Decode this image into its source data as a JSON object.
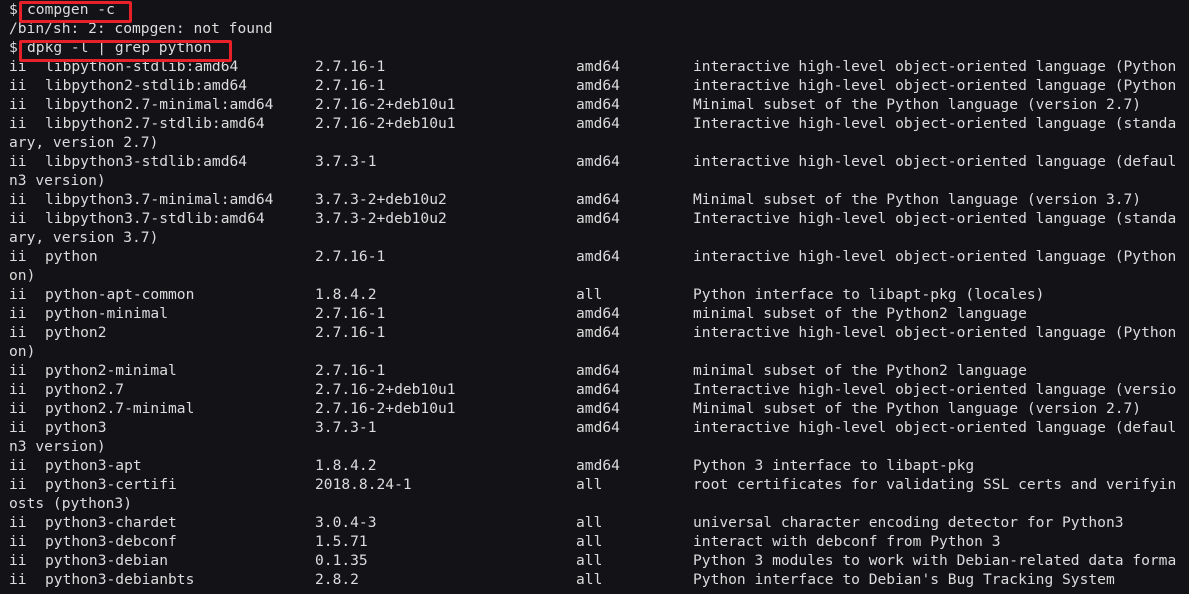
{
  "terminal": {
    "prompt": "$",
    "commands": [
      {
        "text": "compgen -c",
        "highlighted": true
      },
      {
        "text": "dpkg -l | grep python",
        "highlighted": true
      }
    ],
    "error_output": "/bin/sh: 2: compgen: not found",
    "highlight_color": "#e8202a",
    "text_color": "#dcdcdc",
    "background": "#121217",
    "lines": [
      {
        "kind": "cmd",
        "cmd_index": 0
      },
      {
        "kind": "text",
        "text": "/bin/sh: 2: compgen: not found"
      },
      {
        "kind": "cmd",
        "cmd_index": 1
      },
      {
        "kind": "pkg",
        "status": "ii",
        "name": "libpython-stdlib:amd64",
        "version": "2.7.16-1",
        "arch": "amd64",
        "desc": "interactive high-level object-oriented language (Python"
      },
      {
        "kind": "pkg",
        "status": "ii",
        "name": "libpython2-stdlib:amd64",
        "version": "2.7.16-1",
        "arch": "amd64",
        "desc": "interactive high-level object-oriented language (Python"
      },
      {
        "kind": "pkg",
        "status": "ii",
        "name": "libpython2.7-minimal:amd64",
        "version": "2.7.16-2+deb10u1",
        "arch": "amd64",
        "desc": "Minimal subset of the Python language (version 2.7)"
      },
      {
        "kind": "pkg",
        "status": "ii",
        "name": "libpython2.7-stdlib:amd64",
        "version": "2.7.16-2+deb10u1",
        "arch": "amd64",
        "desc": "Interactive high-level object-oriented language (standa"
      },
      {
        "kind": "text",
        "text": "ary, version 2.7)"
      },
      {
        "kind": "pkg",
        "status": "ii",
        "name": "libpython3-stdlib:amd64",
        "version": "3.7.3-1",
        "arch": "amd64",
        "desc": "interactive high-level object-oriented language (defaul"
      },
      {
        "kind": "text",
        "text": "n3 version)"
      },
      {
        "kind": "pkg",
        "status": "ii",
        "name": "libpython3.7-minimal:amd64",
        "version": "3.7.3-2+deb10u2",
        "arch": "amd64",
        "desc": "Minimal subset of the Python language (version 3.7)"
      },
      {
        "kind": "pkg",
        "status": "ii",
        "name": "libpython3.7-stdlib:amd64",
        "version": "3.7.3-2+deb10u2",
        "arch": "amd64",
        "desc": "Interactive high-level object-oriented language (standa"
      },
      {
        "kind": "text",
        "text": "ary, version 3.7)"
      },
      {
        "kind": "pkg",
        "status": "ii",
        "name": "python",
        "version": "2.7.16-1",
        "arch": "amd64",
        "desc": "interactive high-level object-oriented language (Python"
      },
      {
        "kind": "text",
        "text": "on)"
      },
      {
        "kind": "pkg",
        "status": "ii",
        "name": "python-apt-common",
        "version": "1.8.4.2",
        "arch": "all",
        "desc": "Python interface to libapt-pkg (locales)"
      },
      {
        "kind": "pkg",
        "status": "ii",
        "name": "python-minimal",
        "version": "2.7.16-1",
        "arch": "amd64",
        "desc": "minimal subset of the Python2 language"
      },
      {
        "kind": "pkg",
        "status": "ii",
        "name": "python2",
        "version": "2.7.16-1",
        "arch": "amd64",
        "desc": "interactive high-level object-oriented language (Python"
      },
      {
        "kind": "text",
        "text": "on)"
      },
      {
        "kind": "pkg",
        "status": "ii",
        "name": "python2-minimal",
        "version": "2.7.16-1",
        "arch": "amd64",
        "desc": "minimal subset of the Python2 language"
      },
      {
        "kind": "pkg",
        "status": "ii",
        "name": "python2.7",
        "version": "2.7.16-2+deb10u1",
        "arch": "amd64",
        "desc": "Interactive high-level object-oriented language (versio"
      },
      {
        "kind": "pkg",
        "status": "ii",
        "name": "python2.7-minimal",
        "version": "2.7.16-2+deb10u1",
        "arch": "amd64",
        "desc": "Minimal subset of the Python language (version 2.7)"
      },
      {
        "kind": "pkg",
        "status": "ii",
        "name": "python3",
        "version": "3.7.3-1",
        "arch": "amd64",
        "desc": "interactive high-level object-oriented language (defaul"
      },
      {
        "kind": "text",
        "text": "n3 version)"
      },
      {
        "kind": "pkg",
        "status": "ii",
        "name": "python3-apt",
        "version": "1.8.4.2",
        "arch": "amd64",
        "desc": "Python 3 interface to libapt-pkg"
      },
      {
        "kind": "pkg",
        "status": "ii",
        "name": "python3-certifi",
        "version": "2018.8.24-1",
        "arch": "all",
        "desc": "root certificates for validating SSL certs and verifyin"
      },
      {
        "kind": "text",
        "text": "osts (python3)"
      },
      {
        "kind": "pkg",
        "status": "ii",
        "name": "python3-chardet",
        "version": "3.0.4-3",
        "arch": "all",
        "desc": "universal character encoding detector for Python3"
      },
      {
        "kind": "pkg",
        "status": "ii",
        "name": "python3-debconf",
        "version": "1.5.71",
        "arch": "all",
        "desc": "interact with debconf from Python 3"
      },
      {
        "kind": "pkg",
        "status": "ii",
        "name": "python3-debian",
        "version": "0.1.35",
        "arch": "all",
        "desc": "Python 3 modules to work with Debian-related data forma"
      },
      {
        "kind": "pkg",
        "status": "ii",
        "name": "python3-debianbts",
        "version": "2.8.2",
        "arch": "all",
        "desc": "Python interface to Debian's Bug Tracking System"
      }
    ]
  }
}
